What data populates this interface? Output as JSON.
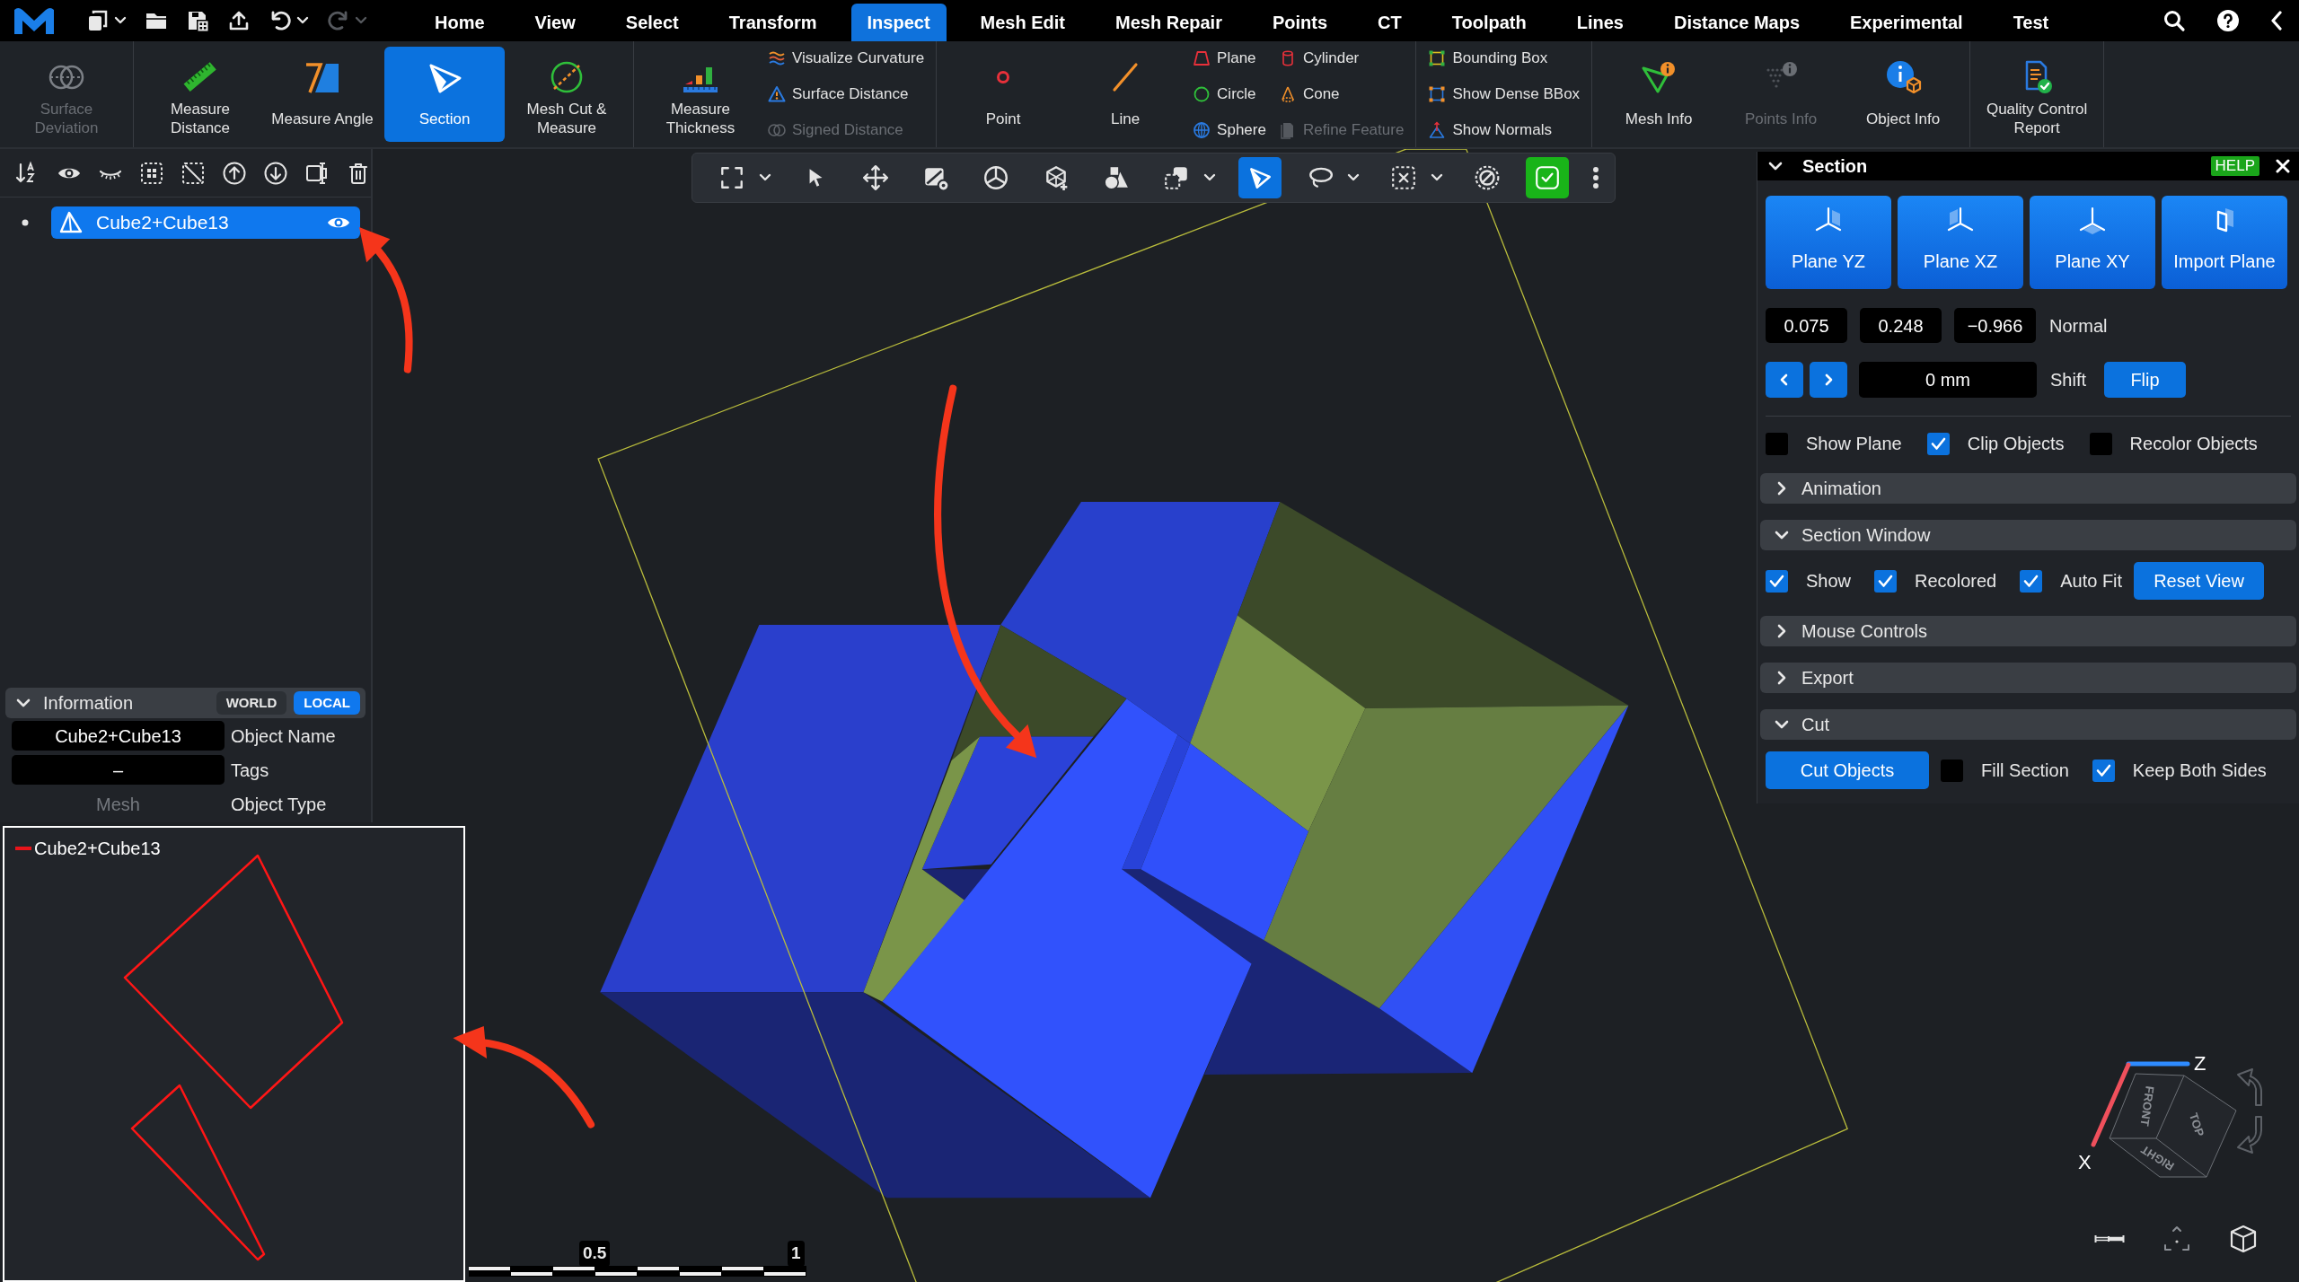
{
  "menu_bar": {
    "quick_actions": [
      {
        "dropdown": true,
        "disabled": false
      },
      {
        "dropdown": false,
        "disabled": false
      },
      {
        "dropdown": false,
        "disabled": false
      },
      {
        "dropdown": false,
        "disabled": false
      },
      {
        "dropdown": true,
        "disabled": false
      },
      {
        "dropdown": true,
        "disabled": true
      }
    ],
    "tabs": [
      {
        "label": "Home",
        "selected": false
      },
      {
        "label": "View",
        "selected": false
      },
      {
        "label": "Select",
        "selected": false
      },
      {
        "label": "Transform",
        "selected": false
      },
      {
        "label": "Inspect",
        "selected": true
      },
      {
        "label": "Mesh Edit",
        "selected": false
      },
      {
        "label": "Mesh Repair",
        "selected": false
      },
      {
        "label": "Points",
        "selected": false
      },
      {
        "label": "CT",
        "selected": false
      },
      {
        "label": "Toolpath",
        "selected": false
      },
      {
        "label": "Lines",
        "selected": false
      },
      {
        "label": "Distance Maps",
        "selected": false
      },
      {
        "label": "Experimental",
        "selected": false
      },
      {
        "label": "Test",
        "selected": false
      }
    ]
  },
  "ribbon": {
    "groups": [
      {
        "items": [
          {
            "kind": "large",
            "label": "Surface Deviation",
            "selected": false,
            "disabled": true
          }
        ]
      },
      {
        "items": [
          {
            "kind": "large",
            "label": "Measure Distance",
            "selected": false,
            "disabled": false
          },
          {
            "kind": "large",
            "label": "Measure Angle",
            "selected": false,
            "disabled": false
          },
          {
            "kind": "large",
            "label": "Section",
            "selected": true,
            "disabled": false
          },
          {
            "kind": "large",
            "label": "Mesh Cut & Measure",
            "selected": false,
            "disabled": false
          }
        ]
      },
      {
        "items": [
          {
            "kind": "large",
            "label": "Measure Thickness",
            "selected": false,
            "disabled": false
          },
          {
            "kind": "small",
            "label": "Visualize Curvature",
            "selected": false,
            "disabled": false
          },
          {
            "kind": "small",
            "label": "Surface Distance",
            "selected": false,
            "disabled": false
          },
          {
            "kind": "small",
            "label": "Signed Distance",
            "selected": false,
            "disabled": true
          }
        ]
      },
      {
        "items": [
          {
            "kind": "large",
            "label": "Point",
            "selected": false,
            "disabled": false
          },
          {
            "kind": "large",
            "label": "Line",
            "selected": false,
            "disabled": false
          },
          {
            "kind": "small",
            "label": "Plane",
            "selected": false,
            "disabled": false
          },
          {
            "kind": "small",
            "label": "Circle",
            "selected": false,
            "disabled": false
          },
          {
            "kind": "small",
            "label": "Sphere",
            "selected": false,
            "disabled": false
          },
          {
            "kind": "small",
            "label": "Cylinder",
            "selected": false,
            "disabled": false
          },
          {
            "kind": "small",
            "label": "Cone",
            "selected": false,
            "disabled": false
          },
          {
            "kind": "small",
            "label": "Refine Feature",
            "selected": false,
            "disabled": true
          }
        ]
      },
      {
        "items": [
          {
            "kind": "small",
            "label": "Bounding Box",
            "selected": false,
            "disabled": false
          },
          {
            "kind": "small",
            "label": "Show Dense BBox",
            "selected": false,
            "disabled": false
          },
          {
            "kind": "small",
            "label": "Show Normals",
            "selected": false,
            "disabled": false
          }
        ]
      },
      {
        "items": [
          {
            "kind": "large",
            "label": "Mesh Info",
            "selected": false,
            "disabled": false
          },
          {
            "kind": "large",
            "label": "Points Info",
            "selected": false,
            "disabled": true
          },
          {
            "kind": "large",
            "label": "Object Info",
            "selected": false,
            "disabled": false
          }
        ]
      },
      {
        "items": [
          {
            "kind": "large",
            "label": "Quality Control Report",
            "selected": false,
            "disabled": false
          }
        ]
      }
    ]
  },
  "objects_panel": {
    "items": [
      {
        "label": "Cube2+Cube13",
        "selected": true,
        "visible": true
      }
    ],
    "information": {
      "title": "Information",
      "expanded": true,
      "modes": [
        {
          "label": "WORLD",
          "selected": false
        },
        {
          "label": "LOCAL",
          "selected": true
        }
      ],
      "rows": [
        {
          "kind": "field",
          "value": "Cube2+Cube13",
          "label": "Object Name"
        },
        {
          "kind": "field",
          "value": "–",
          "label": "Tags"
        },
        {
          "kind": "text",
          "value": "Mesh",
          "label": "Object Type"
        }
      ]
    }
  },
  "viewport_toolbar": [
    {
      "kind": "tool",
      "selected": false,
      "dropdown": true
    },
    {
      "kind": "tool",
      "selected": false,
      "dropdown": false
    },
    {
      "kind": "tool",
      "selected": false,
      "dropdown": false
    },
    {
      "kind": "tool",
      "selected": false,
      "dropdown": false
    },
    {
      "kind": "tool",
      "selected": false,
      "dropdown": false
    },
    {
      "kind": "tool",
      "selected": false,
      "dropdown": false
    },
    {
      "kind": "tool",
      "selected": false,
      "dropdown": false
    },
    {
      "kind": "tool",
      "selected": false,
      "dropdown": true
    },
    {
      "kind": "tool",
      "selected": true,
      "dropdown": false
    },
    {
      "kind": "tool",
      "selected": false,
      "dropdown": true
    },
    {
      "kind": "tool",
      "selected": false,
      "dropdown": true
    },
    {
      "kind": "tool",
      "selected": false,
      "dropdown": false
    },
    {
      "kind": "toggle",
      "selected": true,
      "dropdown": false
    },
    {
      "kind": "menu",
      "selected": false,
      "dropdown": false
    }
  ],
  "section_panel": {
    "title": "Section",
    "expanded": true,
    "help": "HELP",
    "plane_buttons": [
      "Plane YZ",
      "Plane XZ",
      "Plane XY",
      "Import Plane"
    ],
    "normal": {
      "values": [
        "0.075",
        "0.248",
        "−0.966"
      ],
      "label": "Normal"
    },
    "shift": {
      "value": "0 mm",
      "label": "Shift",
      "button": "Flip"
    },
    "options": [
      {
        "label": "Show Plane",
        "checked": false
      },
      {
        "label": "Clip Objects",
        "checked": true
      },
      {
        "label": "Recolor Objects",
        "checked": false
      }
    ],
    "sections": [
      {
        "title": "Animation",
        "expanded": false
      },
      {
        "title": "Section Window",
        "expanded": true,
        "items": [
          {
            "kind": "checkbox",
            "label": "Show",
            "checked": true
          },
          {
            "kind": "checkbox",
            "label": "Recolored",
            "checked": true
          },
          {
            "kind": "checkbox",
            "label": "Auto Fit",
            "checked": true
          },
          {
            "kind": "button",
            "label": "Reset View"
          }
        ]
      },
      {
        "title": "Mouse Controls",
        "expanded": false
      },
      {
        "title": "Export",
        "expanded": false
      },
      {
        "title": "Cut",
        "expanded": true,
        "items": [
          {
            "kind": "button",
            "label": "Cut Objects"
          },
          {
            "kind": "checkbox",
            "label": "Fill Section",
            "checked": false
          },
          {
            "kind": "checkbox",
            "label": "Keep Both Sides",
            "checked": true
          }
        ]
      }
    ]
  },
  "section_window": {
    "legend": "Cube2+Cube13"
  },
  "scale_bar": {
    "ticks": [
      "0.5",
      "1"
    ]
  },
  "view_cube": {
    "axes": [
      "Z",
      "X"
    ],
    "faces": [
      "FRONT",
      "TOP",
      "RIGHT"
    ]
  }
}
